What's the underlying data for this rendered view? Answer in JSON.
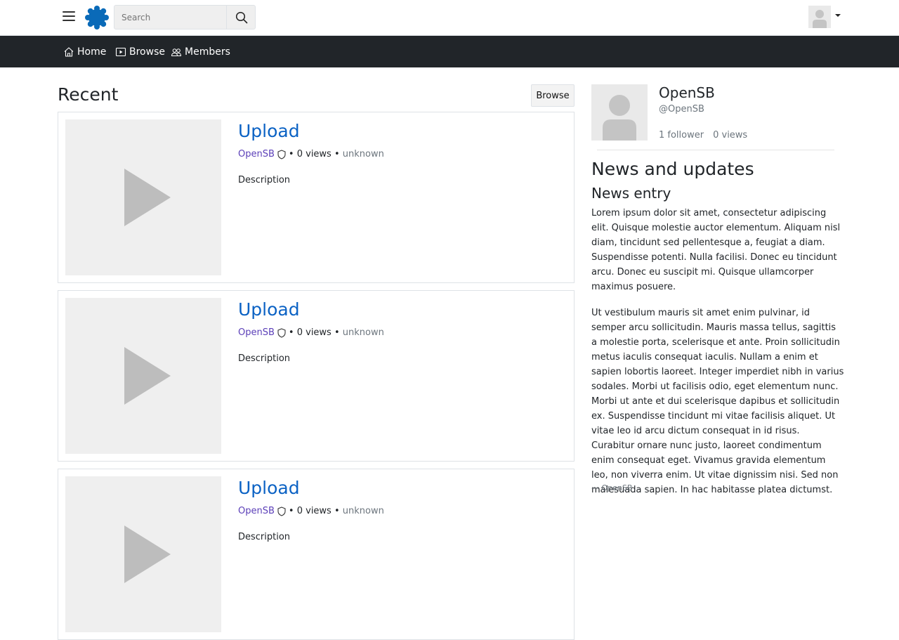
{
  "header": {
    "search_placeholder": "Search",
    "logo_icon": "opensb-gear-icon",
    "accent_color": "#0a6ab8"
  },
  "nav": {
    "home_label": "Home",
    "browse_label": "Browse",
    "members_label": "Members"
  },
  "main": {
    "title": "Recent",
    "browse_button": "Browse",
    "cards": [
      {
        "title": "Upload",
        "author": "OpenSB",
        "sep1": "•",
        "views": "0 views",
        "sep2": "•",
        "date": "unknown",
        "description": "Description"
      },
      {
        "title": "Upload",
        "author": "OpenSB",
        "sep1": "•",
        "views": "0 views",
        "sep2": "•",
        "date": "unknown",
        "description": "Description"
      },
      {
        "title": "Upload",
        "author": "OpenSB",
        "sep1": "•",
        "views": "0 views",
        "sep2": "•",
        "date": "unknown",
        "description": "Description"
      }
    ]
  },
  "sidebar": {
    "profile": {
      "name": "OpenSB",
      "handle": "@OpenSB",
      "followers": "1 follower",
      "views": "0 views"
    },
    "news": {
      "title": "News and updates",
      "entry_title": "News entry",
      "paragraph1": "Lorem ipsum dolor sit amet, consectetur adipiscing elit. Quisque molestie auctor elementum. Aliquam nisl diam, tincidunt sed pellentesque a, feugiat a diam. Suspendisse potenti. Nulla facilisi. Donec eu tincidunt arcu. Donec eu suscipit mi. Quisque ullamcorper maximus posuere.",
      "paragraph2": "Ut vestibulum mauris sit amet enim pulvinar, id semper arcu sollicitudin. Mauris massa tellus, sagittis a molestie porta, scelerisque et ante. Proin sollicitudin metus iaculis consequat iaculis. Nullam a enim et sapien lobortis laoreet. Integer imperdiet nibh in varius sodales. Morbi ut facilisis odio, eget elementum nunc. Morbi ut ante et dui scelerisque dapibus et sollicitudin ex. Suspendisse tincidunt mi vitae facilisis aliquet. Ut vitae leo id arcu dictum consequat in id risus. Curabitur ornare nunc justo, laoreet condimentum enim consequat eget. Vivamus gravida elementum leo, non viverra enim. Ut vitae dignissim nisi. Sed non malesuada sapien. In hac habitasse platea dictumst.",
      "author": "— OpenSB"
    }
  }
}
